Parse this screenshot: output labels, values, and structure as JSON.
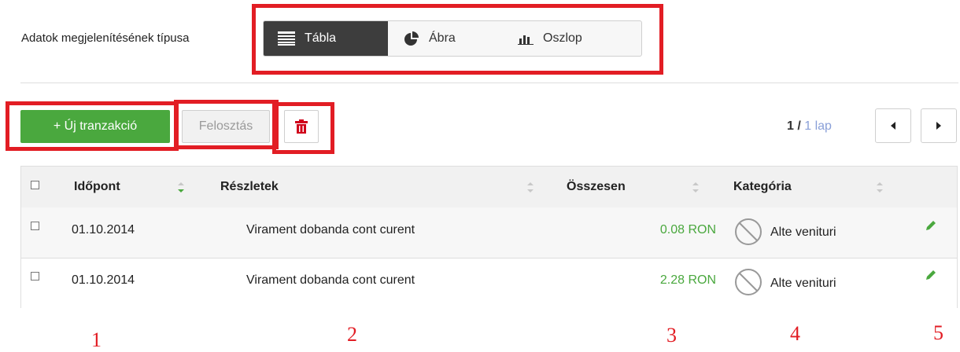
{
  "view_type": {
    "label": "Adatok megjelenítésének típusa",
    "options": [
      {
        "label": "Tábla",
        "icon": "table-icon",
        "active": true
      },
      {
        "label": "Ábra",
        "icon": "pie-chart-icon",
        "active": false
      },
      {
        "label": "Oszlop",
        "icon": "bar-chart-icon",
        "active": false
      }
    ]
  },
  "toolbar": {
    "new_transaction": "+ Új tranzakció",
    "split": "Felosztás",
    "delete_icon": "trash-icon"
  },
  "pager": {
    "current": "1",
    "separator": " / ",
    "total": "1 lap"
  },
  "table": {
    "columns": [
      "Időpont",
      "Részletek",
      "Összesen",
      "Kategória"
    ],
    "rows": [
      {
        "date": "01.10.2014",
        "details": "Virament dobanda cont curent",
        "amount": "0.08 RON",
        "category": "Alte venituri"
      },
      {
        "date": "01.10.2014",
        "details": "Virament dobanda cont curent",
        "amount": "2.28 RON",
        "category": "Alte venituri"
      }
    ]
  },
  "annotations": [
    "1",
    "2",
    "3",
    "4",
    "5"
  ],
  "colors": {
    "accent_green": "#4aa83e",
    "highlight_red": "#e21d24",
    "active_dark": "#3d3d3d",
    "pager_total": "#8aa0d8"
  }
}
